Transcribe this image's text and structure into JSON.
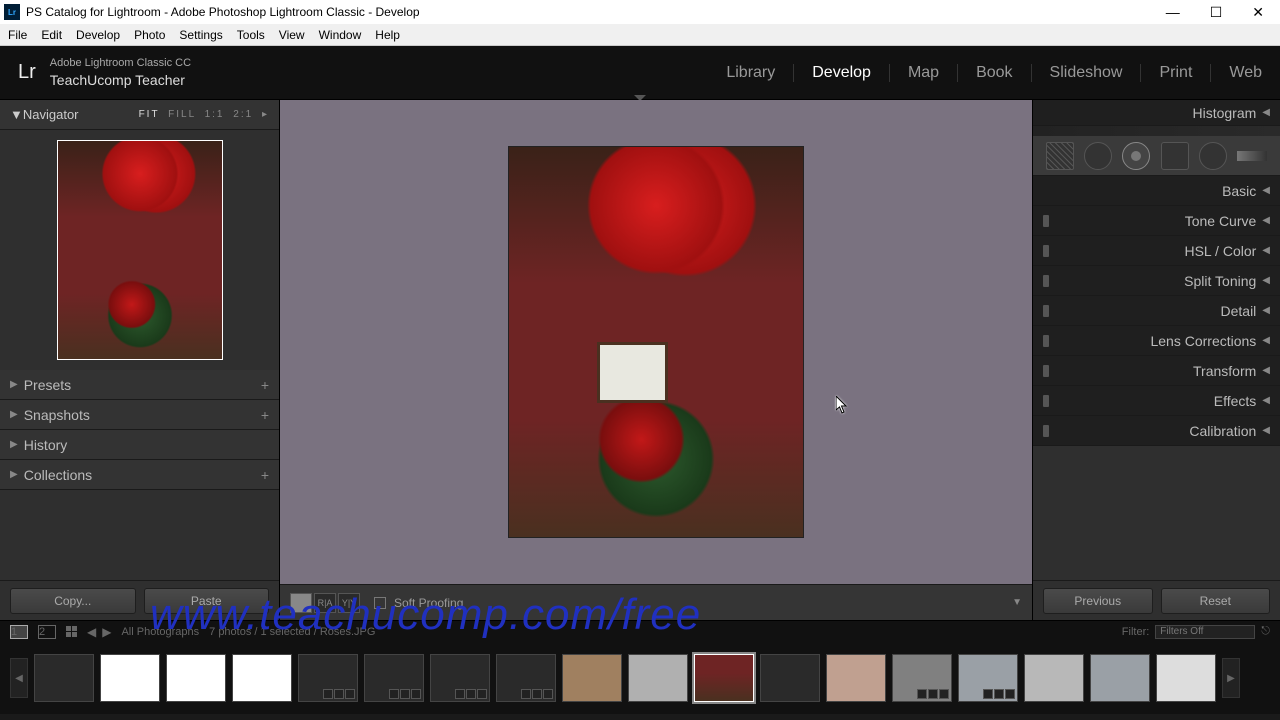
{
  "window": {
    "title": "PS Catalog for Lightroom - Adobe Photoshop Lightroom Classic - Develop",
    "logo_short": "Lr"
  },
  "menubar": [
    "File",
    "Edit",
    "Develop",
    "Photo",
    "Settings",
    "Tools",
    "View",
    "Window",
    "Help"
  ],
  "identity": {
    "product": "Adobe Lightroom Classic CC",
    "account": "TeachUcomp Teacher"
  },
  "modules": [
    "Library",
    "Develop",
    "Map",
    "Book",
    "Slideshow",
    "Print",
    "Web"
  ],
  "active_module": "Develop",
  "navigator": {
    "label": "Navigator",
    "zoom_opts": [
      "FIT",
      "FILL",
      "1:1",
      "2:1"
    ],
    "zoom_selected": "FIT"
  },
  "left_panels": [
    {
      "label": "Presets",
      "add": "+"
    },
    {
      "label": "Snapshots",
      "add": "+"
    },
    {
      "label": "History",
      "add": ""
    },
    {
      "label": "Collections",
      "add": "+"
    }
  ],
  "left_buttons": {
    "copy": "Copy...",
    "paste": "Paste"
  },
  "right_panels_top": "Histogram",
  "right_panels": [
    {
      "label": "Basic",
      "switch": false
    },
    {
      "label": "Tone Curve",
      "switch": true
    },
    {
      "label": "HSL / Color",
      "switch": true
    },
    {
      "label": "Split Toning",
      "switch": true
    },
    {
      "label": "Detail",
      "switch": true
    },
    {
      "label": "Lens Corrections",
      "switch": true
    },
    {
      "label": "Transform",
      "switch": true
    },
    {
      "label": "Effects",
      "switch": true
    },
    {
      "label": "Calibration",
      "switch": true
    }
  ],
  "right_buttons": {
    "prev": "Previous",
    "reset": "Reset"
  },
  "center_bar": {
    "soft_proof": "Soft Proofing",
    "view_labels": [
      "",
      "R|A",
      "Y|Y"
    ]
  },
  "filmstrip_head": {
    "screens": [
      "1",
      "2"
    ],
    "breadcrumb_left": "All Photographs",
    "breadcrumb_mid": "7 photos / 1 selected / Roses.JPG",
    "filter_label": "Filter:",
    "filters_off": "Filters Off"
  },
  "watermark": "www.teachucomp.com/free"
}
